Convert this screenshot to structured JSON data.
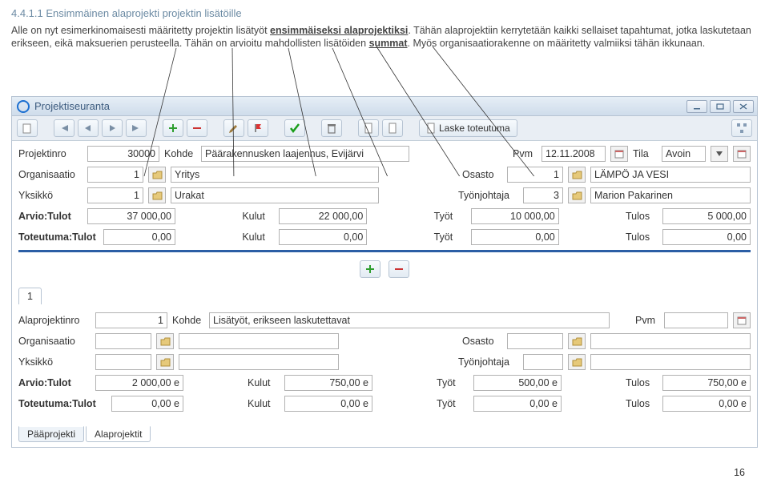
{
  "heading": "4.4.1.1 Ensimmäinen alaprojekti projektin lisätöille",
  "para_1a": "Alle on nyt esimerkinomaisesti määritetty projektin lisätyöt ",
  "para_1b": "ensimmäiseksi alaprojektiksi",
  "para_1c": ". Tähän alaprojektiin kerrytetään kaikki sellaiset tapahtumat, jotka laskutetaan erikseen, eikä maksuerien perusteella. Tähän on arvioitu mahdollisten lisätöiden ",
  "para_1d": "summat",
  "para_1e": ". Myös organisaatiorakenne on määritetty valmiiksi tähän ikkunaan.",
  "window_title": "Projektiseuranta",
  "toolbar": {
    "compute_label": "Laske toteutuma"
  },
  "main": {
    "project_no_lbl": "Projektinro",
    "project_no": "30000",
    "target_lbl": "Kohde",
    "target": "Päärakennusken laajennus, Evijärvi",
    "date_lbl": "Pvm",
    "date": "12.11.2008",
    "state_lbl": "Tila",
    "state": "Avoin",
    "org_lbl": "Organisaatio",
    "org": "1",
    "org_name": "Yritys",
    "dept_lbl": "Osasto",
    "dept": "1",
    "dept_name": "LÄMPÖ JA VESI",
    "unit_lbl": "Yksikkö",
    "unit": "1",
    "unit_name": "Urakat",
    "foreman_lbl": "Työnjohtaja",
    "foreman": "3",
    "foreman_name": "Marion Pakarinen",
    "est_lbl": "Arvio:Tulot",
    "est_income": "37 000,00",
    "kulut_lbl": "Kulut",
    "est_cost": "22 000,00",
    "tyot_lbl": "Työt",
    "est_work": "10 000,00",
    "tulos_lbl": "Tulos",
    "est_result": "5 000,00",
    "act_lbl": "Toteutuma:Tulot",
    "act_income": "0,00",
    "act_cost": "0,00",
    "act_work": "0,00",
    "act_result": "0,00"
  },
  "sub": {
    "tab_label": "1",
    "sp_no_lbl": "Alaprojektinro",
    "sp_no": "1",
    "target_lbl": "Kohde",
    "target": "Lisätyöt, erikseen laskutettavat",
    "date_lbl": "Pvm",
    "org_lbl": "Organisaatio",
    "dept_lbl": "Osasto",
    "unit_lbl": "Yksikkö",
    "foreman_lbl": "Työnjohtaja",
    "est_lbl": "Arvio:Tulot",
    "est_income": "2 000,00 e",
    "kulut_lbl": "Kulut",
    "est_cost": "750,00 e",
    "tyot_lbl": "Työt",
    "est_work": "500,00 e",
    "tulos_lbl": "Tulos",
    "est_result": "750,00 e",
    "act_lbl": "Toteutuma:Tulot",
    "act_income": "0,00 e",
    "act_cost": "0,00 e",
    "act_work": "0,00 e",
    "act_result": "0,00 e"
  },
  "bottom_tabs": {
    "main": "Pääprojekti",
    "sub": "Alaprojektit"
  },
  "page_number": "16"
}
